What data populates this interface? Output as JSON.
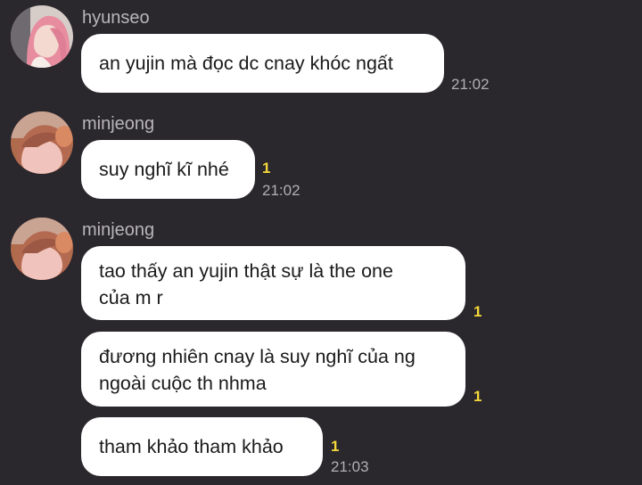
{
  "messages": [
    {
      "sender": "hyunseo",
      "avatar_icon": "avatar-photo-pink-hair-icon",
      "lines": [
        "an yujin mà đọc dc cnay khóc ngất"
      ],
      "time": "21:02",
      "unread": ""
    },
    {
      "sender": "minjeong",
      "avatar_icon": "avatar-photo-icon",
      "lines": [
        "suy nghĩ kĩ nhé"
      ],
      "time": "21:02",
      "unread": "1"
    },
    {
      "sender": "minjeong",
      "avatar_icon": "avatar-photo-icon",
      "lines": [
        "tao thấy an yujin thật sự là the one",
        "của m r"
      ],
      "time": "",
      "unread": "1"
    },
    {
      "sender": "",
      "lines": [
        "đương nhiên cnay là suy nghĩ của ng",
        "ngoài cuộc th nhma"
      ],
      "time": "",
      "unread": "1"
    },
    {
      "sender": "",
      "lines": [
        "tham khảo tham khảo"
      ],
      "time": "21:03",
      "unread": "1"
    }
  ],
  "colors": {
    "background": "#2a272d",
    "bubble": "#ffffff",
    "unread_badge": "#f4d83a",
    "timestamp": "#b2aeb6",
    "sender_name": "#b9b5bc"
  }
}
